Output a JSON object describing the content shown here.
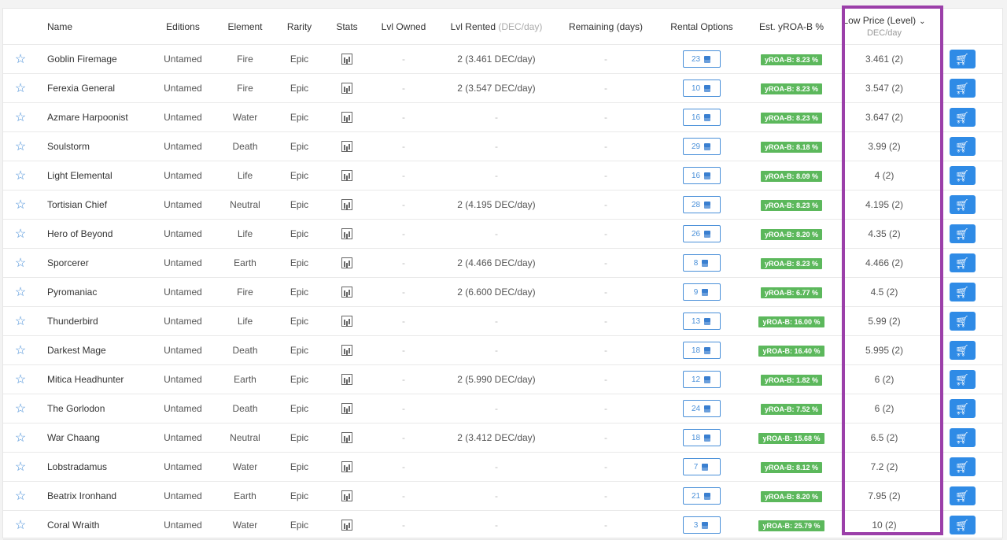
{
  "headers": {
    "name": "Name",
    "editions": "Editions",
    "element": "Element",
    "rarity": "Rarity",
    "stats": "Stats",
    "lvl_owned": "Lvl Owned",
    "lvl_rented": "Lvl Rented",
    "lvl_rented_unit": "(DEC/day)",
    "remaining": "Remaining (days)",
    "rental_options": "Rental Options",
    "est_yroa": "Est. yROA-B %",
    "low_price": "Low Price (Level)",
    "low_price_unit": "DEC/day"
  },
  "rows": [
    {
      "name": "Goblin Firemage",
      "edition": "Untamed",
      "element": "Fire",
      "rarity": "Epic",
      "owned": "-",
      "rented": "2 (3.461 DEC/day)",
      "remaining": "-",
      "options": "23",
      "yroa": "yROA-B: 8.23 %",
      "price": "3.461 (2)"
    },
    {
      "name": "Ferexia General",
      "edition": "Untamed",
      "element": "Fire",
      "rarity": "Epic",
      "owned": "-",
      "rented": "2 (3.547 DEC/day)",
      "remaining": "-",
      "options": "10",
      "yroa": "yROA-B: 8.23 %",
      "price": "3.547 (2)"
    },
    {
      "name": "Azmare Harpoonist",
      "edition": "Untamed",
      "element": "Water",
      "rarity": "Epic",
      "owned": "-",
      "rented": "-",
      "remaining": "-",
      "options": "16",
      "yroa": "yROA-B: 8.23 %",
      "price": "3.647 (2)"
    },
    {
      "name": "Soulstorm",
      "edition": "Untamed",
      "element": "Death",
      "rarity": "Epic",
      "owned": "-",
      "rented": "-",
      "remaining": "-",
      "options": "29",
      "yroa": "yROA-B: 8.18 %",
      "price": "3.99 (2)"
    },
    {
      "name": "Light Elemental",
      "edition": "Untamed",
      "element": "Life",
      "rarity": "Epic",
      "owned": "-",
      "rented": "-",
      "remaining": "-",
      "options": "16",
      "yroa": "yROA-B: 8.09 %",
      "price": "4 (2)"
    },
    {
      "name": "Tortisian Chief",
      "edition": "Untamed",
      "element": "Neutral",
      "rarity": "Epic",
      "owned": "-",
      "rented": "2 (4.195 DEC/day)",
      "remaining": "-",
      "options": "28",
      "yroa": "yROA-B: 8.23 %",
      "price": "4.195 (2)"
    },
    {
      "name": "Hero of Beyond",
      "edition": "Untamed",
      "element": "Life",
      "rarity": "Epic",
      "owned": "-",
      "rented": "-",
      "remaining": "-",
      "options": "26",
      "yroa": "yROA-B: 8.20 %",
      "price": "4.35 (2)"
    },
    {
      "name": "Sporcerer",
      "edition": "Untamed",
      "element": "Earth",
      "rarity": "Epic",
      "owned": "-",
      "rented": "2 (4.466 DEC/day)",
      "remaining": "-",
      "options": "8",
      "yroa": "yROA-B: 8.23 %",
      "price": "4.466 (2)"
    },
    {
      "name": "Pyromaniac",
      "edition": "Untamed",
      "element": "Fire",
      "rarity": "Epic",
      "owned": "-",
      "rented": "2 (6.600 DEC/day)",
      "remaining": "-",
      "options": "9",
      "yroa": "yROA-B: 6.77 %",
      "price": "4.5 (2)"
    },
    {
      "name": "Thunderbird",
      "edition": "Untamed",
      "element": "Life",
      "rarity": "Epic",
      "owned": "-",
      "rented": "-",
      "remaining": "-",
      "options": "13",
      "yroa": "yROA-B: 16.00 %",
      "price": "5.99 (2)"
    },
    {
      "name": "Darkest Mage",
      "edition": "Untamed",
      "element": "Death",
      "rarity": "Epic",
      "owned": "-",
      "rented": "-",
      "remaining": "-",
      "options": "18",
      "yroa": "yROA-B: 16.40 %",
      "price": "5.995 (2)"
    },
    {
      "name": "Mitica Headhunter",
      "edition": "Untamed",
      "element": "Earth",
      "rarity": "Epic",
      "owned": "-",
      "rented": "2 (5.990 DEC/day)",
      "remaining": "-",
      "options": "12",
      "yroa": "yROA-B: 1.82 %",
      "price": "6 (2)"
    },
    {
      "name": "The Gorlodon",
      "edition": "Untamed",
      "element": "Death",
      "rarity": "Epic",
      "owned": "-",
      "rented": "-",
      "remaining": "-",
      "options": "24",
      "yroa": "yROA-B: 7.52 %",
      "price": "6 (2)"
    },
    {
      "name": "War Chaang",
      "edition": "Untamed",
      "element": "Neutral",
      "rarity": "Epic",
      "owned": "-",
      "rented": "2 (3.412 DEC/day)",
      "remaining": "-",
      "options": "18",
      "yroa": "yROA-B: 15.68 %",
      "price": "6.5 (2)"
    },
    {
      "name": "Lobstradamus",
      "edition": "Untamed",
      "element": "Water",
      "rarity": "Epic",
      "owned": "-",
      "rented": "-",
      "remaining": "-",
      "options": "7",
      "yroa": "yROA-B: 8.12 %",
      "price": "7.2 (2)"
    },
    {
      "name": "Beatrix Ironhand",
      "edition": "Untamed",
      "element": "Earth",
      "rarity": "Epic",
      "owned": "-",
      "rented": "-",
      "remaining": "-",
      "options": "21",
      "yroa": "yROA-B: 8.20 %",
      "price": "7.95 (2)"
    },
    {
      "name": "Coral Wraith",
      "edition": "Untamed",
      "element": "Water",
      "rarity": "Epic",
      "owned": "-",
      "rented": "-",
      "remaining": "-",
      "options": "3",
      "yroa": "yROA-B: 25.79 %",
      "price": "10 (2)"
    }
  ],
  "colors": {
    "accent": "#2f8be6",
    "yroa_badge": "#5cb85c",
    "highlight": "#9b3fa9"
  },
  "icons": {
    "favorite": "star-outline-icon",
    "stats": "stats-chart-icon",
    "rental": "layers-icon",
    "buy": "cart-icon",
    "sort": "chevron-down-icon"
  }
}
